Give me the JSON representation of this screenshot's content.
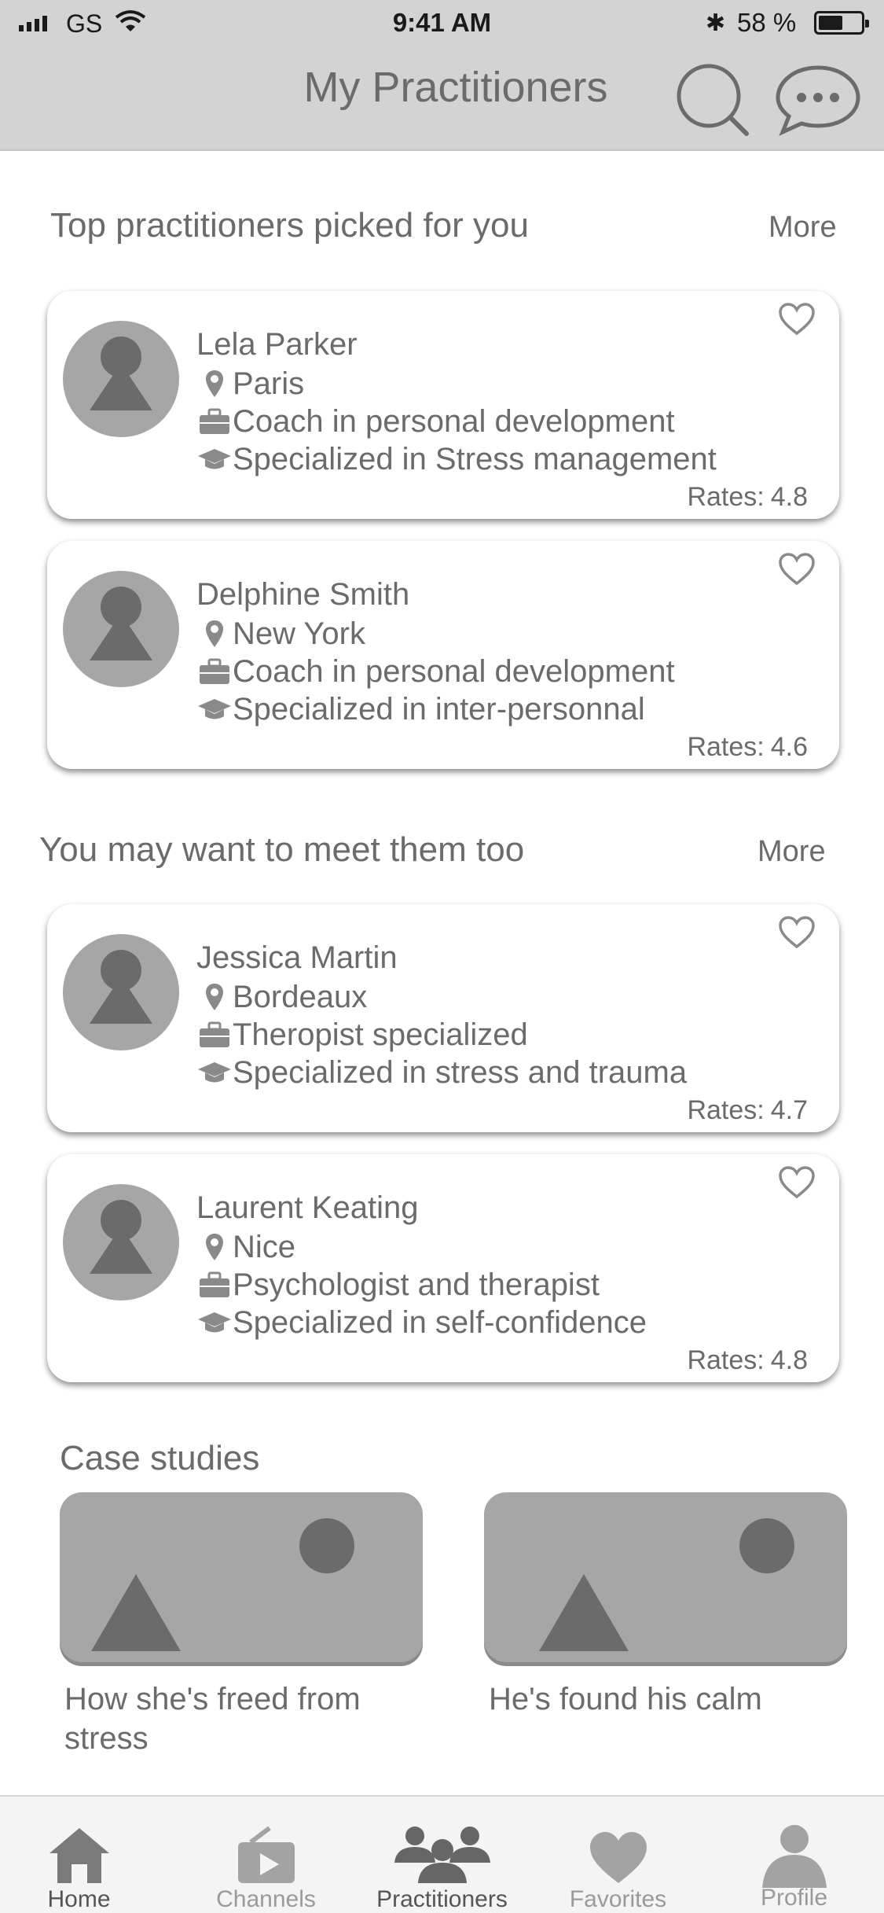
{
  "status_bar": {
    "carrier": "GS",
    "time": "9:41 AM",
    "battery_percent": "58 %",
    "battery_level": 0.58
  },
  "header": {
    "title": "My Practitioners",
    "icons": [
      "search-icon",
      "chat-bubble-icon"
    ]
  },
  "sections": {
    "top": {
      "title": "Top practitioners picked for you",
      "more": "More"
    },
    "meet": {
      "title": "You may want to meet them too",
      "more": "More"
    },
    "case": {
      "title": "Case studies"
    }
  },
  "practitioners": [
    {
      "name": "Lela Parker",
      "location": "Paris",
      "job": "Coach in personal development",
      "speciality": "Specialized in Stress management",
      "rates_label": "Rates:",
      "rate": "4.8"
    },
    {
      "name": "Delphine Smith",
      "location": "New York",
      "job": "Coach in personal development",
      "speciality": "Specialized in inter-personnal",
      "rates_label": "Rates:",
      "rate": "4.6"
    },
    {
      "name": "Jessica Martin",
      "location": "Bordeaux",
      "job": "Theropist specialized",
      "speciality": "Specialized in stress and trauma",
      "rates_label": "Rates:",
      "rate": "4.7"
    },
    {
      "name": "Laurent Keating",
      "location": "Nice",
      "job": "Psychologist and therapist",
      "speciality": "Specialized in self-confidence",
      "rates_label": "Rates:",
      "rate": "4.8"
    }
  ],
  "case_studies": [
    {
      "caption": "How she's freed from stress"
    },
    {
      "caption": "He's found his calm"
    }
  ],
  "tabs": [
    {
      "label": "Home",
      "icon": "home-icon"
    },
    {
      "label": "Channels",
      "icon": "channels-icon"
    },
    {
      "label": "Practitioners",
      "icon": "practitioners-icon",
      "active": true
    },
    {
      "label": "Favorites",
      "icon": "heart-icon"
    },
    {
      "label": "Profile",
      "icon": "profile-icon"
    }
  ],
  "colors": {
    "header_bg": "#d3d3d3",
    "placeholder": "#a6a6a6",
    "placeholder_dark": "#6b6b6b",
    "text": "#6b6b6b"
  }
}
